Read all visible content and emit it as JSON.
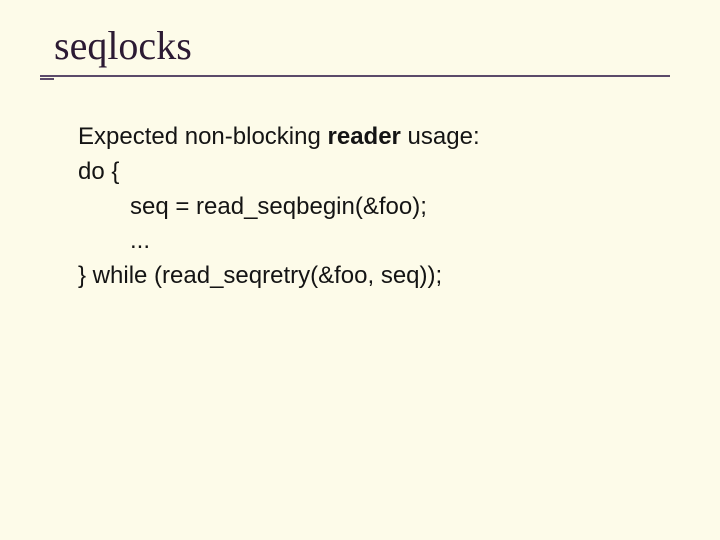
{
  "title": "seqlocks",
  "body": {
    "intro_prefix": "Expected non-blocking ",
    "intro_bold": "reader",
    "intro_suffix": " usage:",
    "line_do": "do {",
    "line_seq": "seq = read_seqbegin(&foo);",
    "line_ellipsis": "...",
    "line_while": "} while (read_seqretry(&foo, seq));"
  }
}
